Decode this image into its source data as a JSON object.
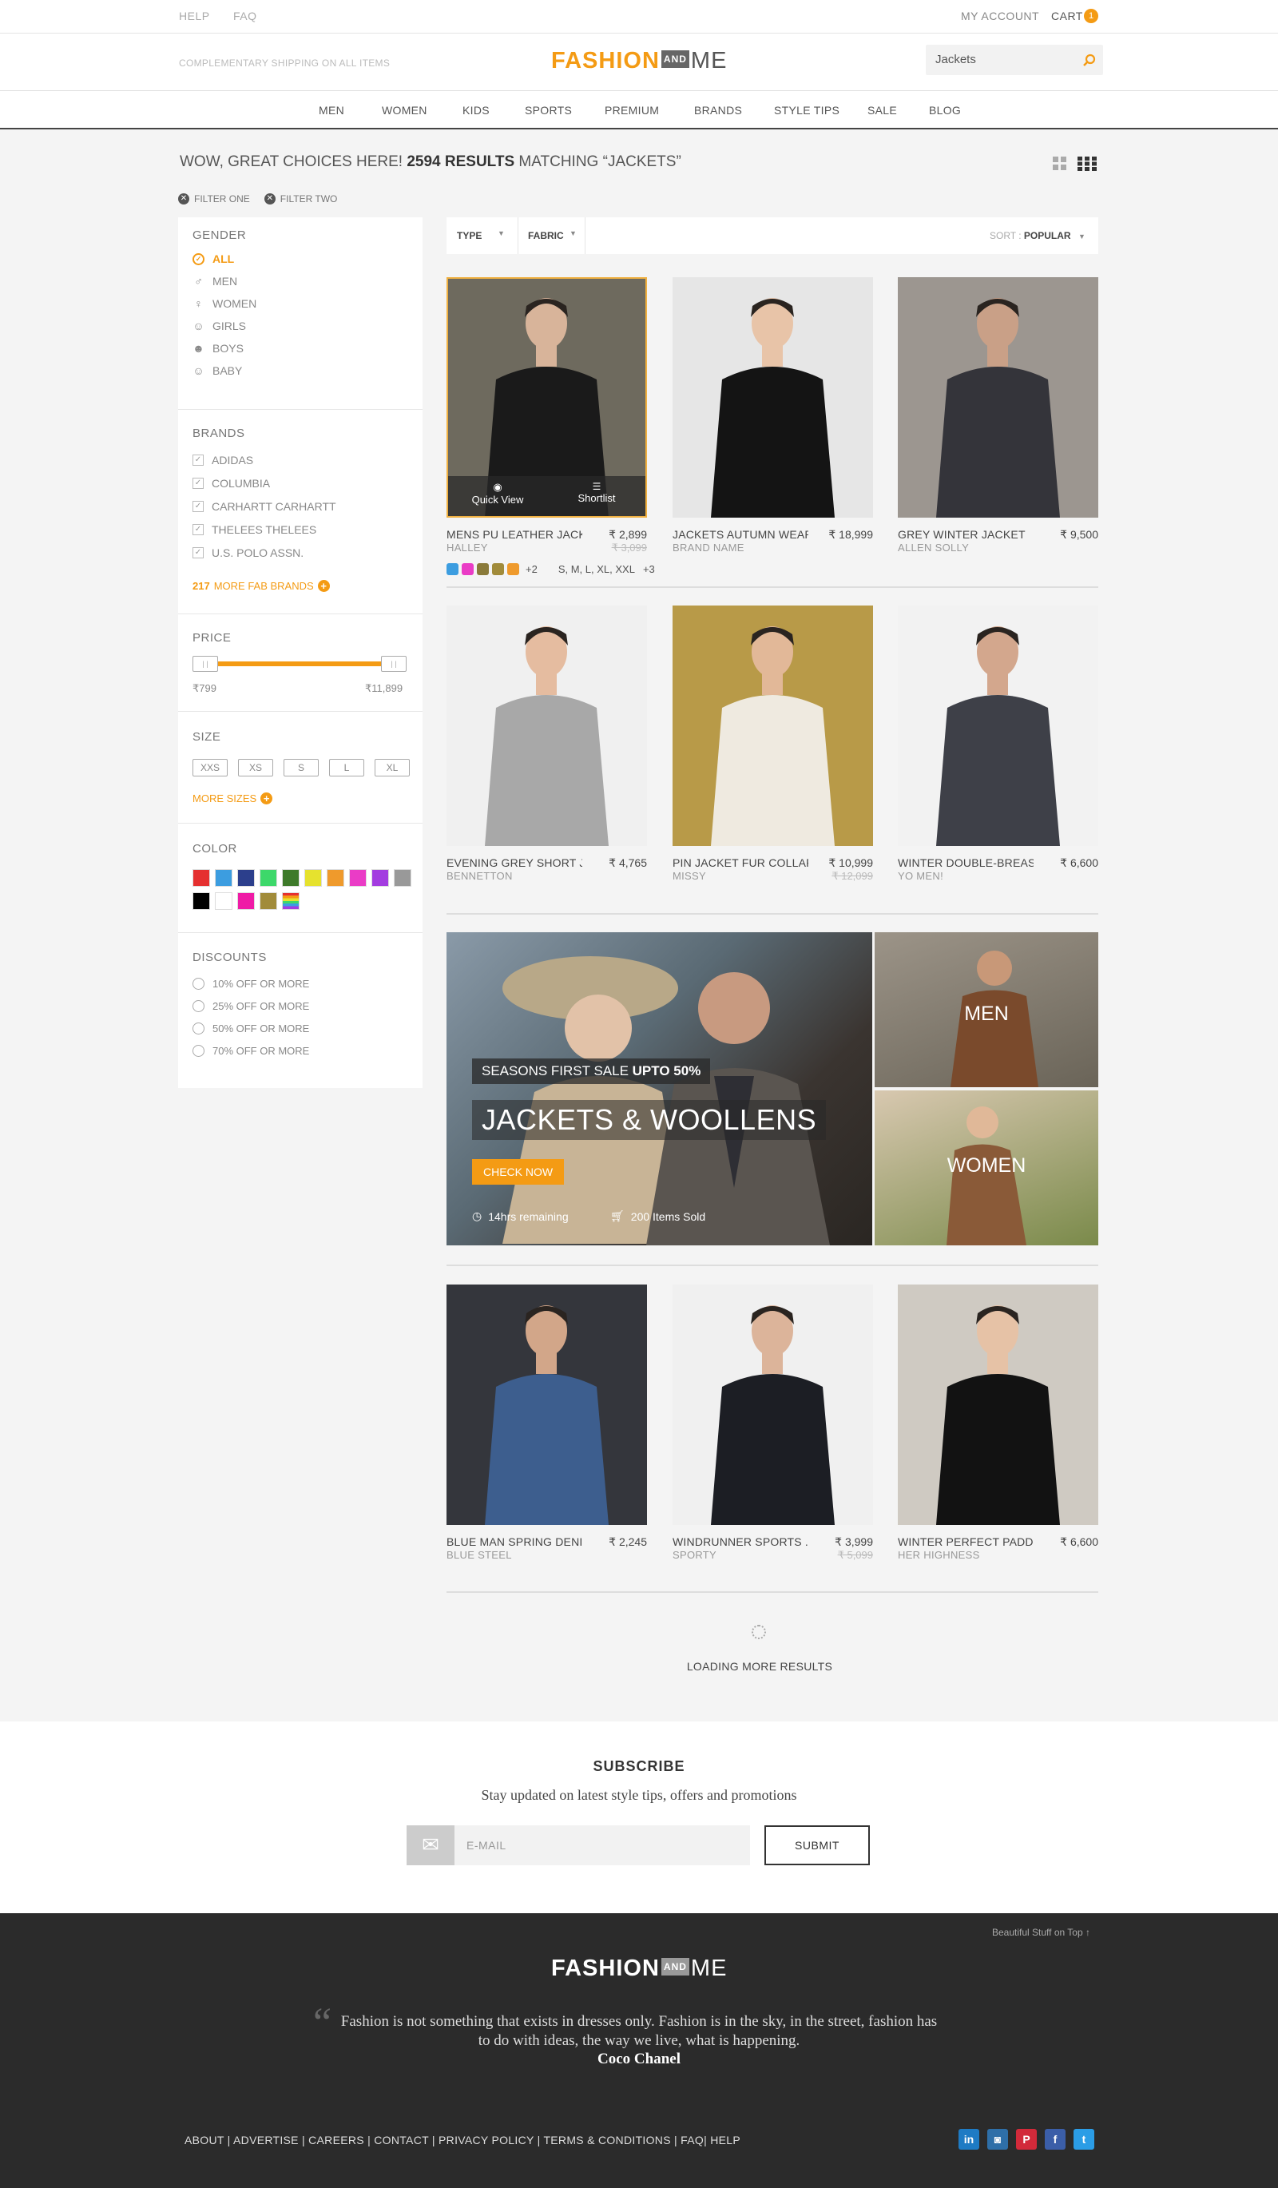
{
  "topbar": {
    "help": "HELP",
    "faq": "FAQ",
    "account": "MY ACCOUNT",
    "cart": "CART",
    "cart_count": "1"
  },
  "header": {
    "shipping": "COMPLEMENTARY SHIPPING ON ALL ITEMS",
    "logo_left": "FASHION",
    "logo_and": "AND",
    "logo_right": "ME",
    "search_value": "Jackets"
  },
  "nav": [
    "MEN",
    "WOMEN",
    "KIDS",
    "SPORTS",
    "PREMIUM",
    "BRANDS",
    "STYLE TIPS",
    "SALE",
    "BLOG"
  ],
  "results": {
    "prefix": "WOW, GREAT CHOICES HERE!",
    "count": "2594 RESULTS",
    "suffix": "MATCHING “JACKETS”"
  },
  "active_filters": [
    "FILTER ONE",
    "FILTER TWO"
  ],
  "sidebar": {
    "gender_title": "GENDER",
    "gender": [
      "ALL",
      "MEN",
      "WOMEN",
      "GIRLS",
      "BOYS",
      "BABY"
    ],
    "brands_title": "BRANDS",
    "brands": [
      "ADIDAS",
      "COLUMBIA",
      "CARHARTT CARHARTT",
      "THELEES THELEES",
      "U.S. POLO ASSN."
    ],
    "more_brands_count": "217",
    "more_brands": "MORE FAB BRANDS",
    "price_title": "PRICE",
    "price_min": "₹799",
    "price_max": "₹11,899",
    "size_title": "SIZE",
    "sizes": [
      "XXS",
      "XS",
      "S",
      "L",
      "XL"
    ],
    "more_sizes": "MORE SIZES",
    "color_title": "COLOR",
    "colors": [
      "#e53030",
      "#3c9de0",
      "#2c3f8c",
      "#3dd86a",
      "#3e7a2a",
      "#e6e22e",
      "#ef9a2c",
      "#ea3cc6",
      "#a33ce0",
      "#999999",
      "#000000",
      "#ffffff",
      "#ef1ba6",
      "#a18b3a",
      "rainbow"
    ],
    "discount_title": "DISCOUNTS",
    "discounts": [
      "10% OFF OR MORE",
      "25% OFF OR MORE",
      "50% OFF OR MORE",
      "70% OFF OR MORE"
    ]
  },
  "filterbar": {
    "type": "TYPE",
    "fabric": "FABRIC",
    "sort_label": "SORT :",
    "sort_value": "POPULAR"
  },
  "products": [
    {
      "name": "MENS PU LEATHER JACK...",
      "brand": "HALLEY",
      "price": "₹ 2,899",
      "old": "₹ 3,099",
      "bg": "#6e6a5e",
      "fg": "#1a1a1a",
      "skin": "#d8b49a"
    },
    {
      "name": "JACKETS AUTUMN WEAR ...",
      "brand": "BRAND NAME",
      "price": "₹ 18,999",
      "old": "",
      "bg": "#e6e6e6",
      "fg": "#141414",
      "skin": "#e8c4a8"
    },
    {
      "name": "GREY WINTER JACKET",
      "brand": "ALLEN SOLLY",
      "price": "₹ 9,500",
      "old": "",
      "bg": "#9c9690",
      "fg": "#34343a",
      "skin": "#c9a087"
    },
    {
      "name": "EVENING GREY SHORT JA ...",
      "brand": "BENNETTON",
      "price": "₹ 4,765",
      "old": "",
      "bg": "#f0f0f0",
      "fg": "#a8a8a8",
      "skin": "#e5bca0"
    },
    {
      "name": "PIN JACKET FUR COLLAR ...",
      "brand": "MISSY",
      "price": "₹ 10,999",
      "old": "₹ 12,099",
      "bg": "#b89a48",
      "fg": "#efeae0",
      "skin": "#e2b898"
    },
    {
      "name": "WINTER DOUBLE-BREAS...",
      "brand": "YO MEN!",
      "price": "₹ 6,600",
      "old": "",
      "bg": "#f2f2f2",
      "fg": "#3e4048",
      "skin": "#d3a78d"
    },
    {
      "name": "BLUE MAN SPRING DENIM ...",
      "brand": "BLUE STEEL",
      "price": "₹ 2,245",
      "old": "",
      "bg": "#34363c",
      "fg": "#3d5e8e",
      "skin": "#d2a689"
    },
    {
      "name": "WINDRUNNER SPORTS ...",
      "brand": "SPORTY",
      "price": "₹ 3,999",
      "old": "₹ 5,099",
      "bg": "#f0f0f0",
      "fg": "#1c1e24",
      "skin": "#dcb49a"
    },
    {
      "name": "WINTER PERFECT PADDED ...",
      "brand": "HER HIGHNESS",
      "price": "₹ 6,600",
      "old": "",
      "bg": "#cfcac2",
      "fg": "#121212",
      "skin": "#e6c2a6"
    }
  ],
  "card_overlay": {
    "quick_view": "Quick View",
    "shortlist": "Shortlist",
    "swatches": [
      "#3c9de0",
      "#ea3cc6",
      "#8a7a3a",
      "#a18b3a",
      "#ef9a2c"
    ],
    "more_colors": "+2",
    "sizes": "S, M, L, XL, XXL",
    "more_sizes": "+3"
  },
  "banner": {
    "tag_prefix": "SEASONS FIRST SALE",
    "tag_bold": "UPTO 50%",
    "title": "JACKETS & WOOLLENS",
    "cta": "CHECK NOW",
    "time": "14hrs remaining",
    "sold": "200 Items Sold",
    "men": "MEN",
    "women": "WOMEN"
  },
  "loading": "LOADING MORE RESULTS",
  "subscribe": {
    "title": "SUBSCRIBE",
    "text": "Stay updated on latest style tips, offers and promotions",
    "placeholder": "E-MAIL",
    "submit": "SUBMIT"
  },
  "footer": {
    "top_link": "Beautiful Stuff on Top",
    "quote": "Fashion is not something that exists in dresses only. Fashion is in the sky, in the street, fashion has to do with ideas, the way we live, what is happening.",
    "author": "Coco Chanel",
    "links": "ABOUT | ADVERTISE | CAREERS | CONTACT | PRIVACY POLICY | TERMS & CONDITIONS | FAQ| HELP",
    "social": [
      {
        "name": "linkedin-icon",
        "label": "in",
        "color": "#1e7bc4"
      },
      {
        "name": "instagram-icon",
        "label": "◙",
        "color": "#2e6fa8"
      },
      {
        "name": "pinterest-icon",
        "label": "P",
        "color": "#d22a3a"
      },
      {
        "name": "facebook-icon",
        "label": "f",
        "color": "#3b5ea8"
      },
      {
        "name": "twitter-icon",
        "label": "t",
        "color": "#2b9de6"
      }
    ]
  }
}
